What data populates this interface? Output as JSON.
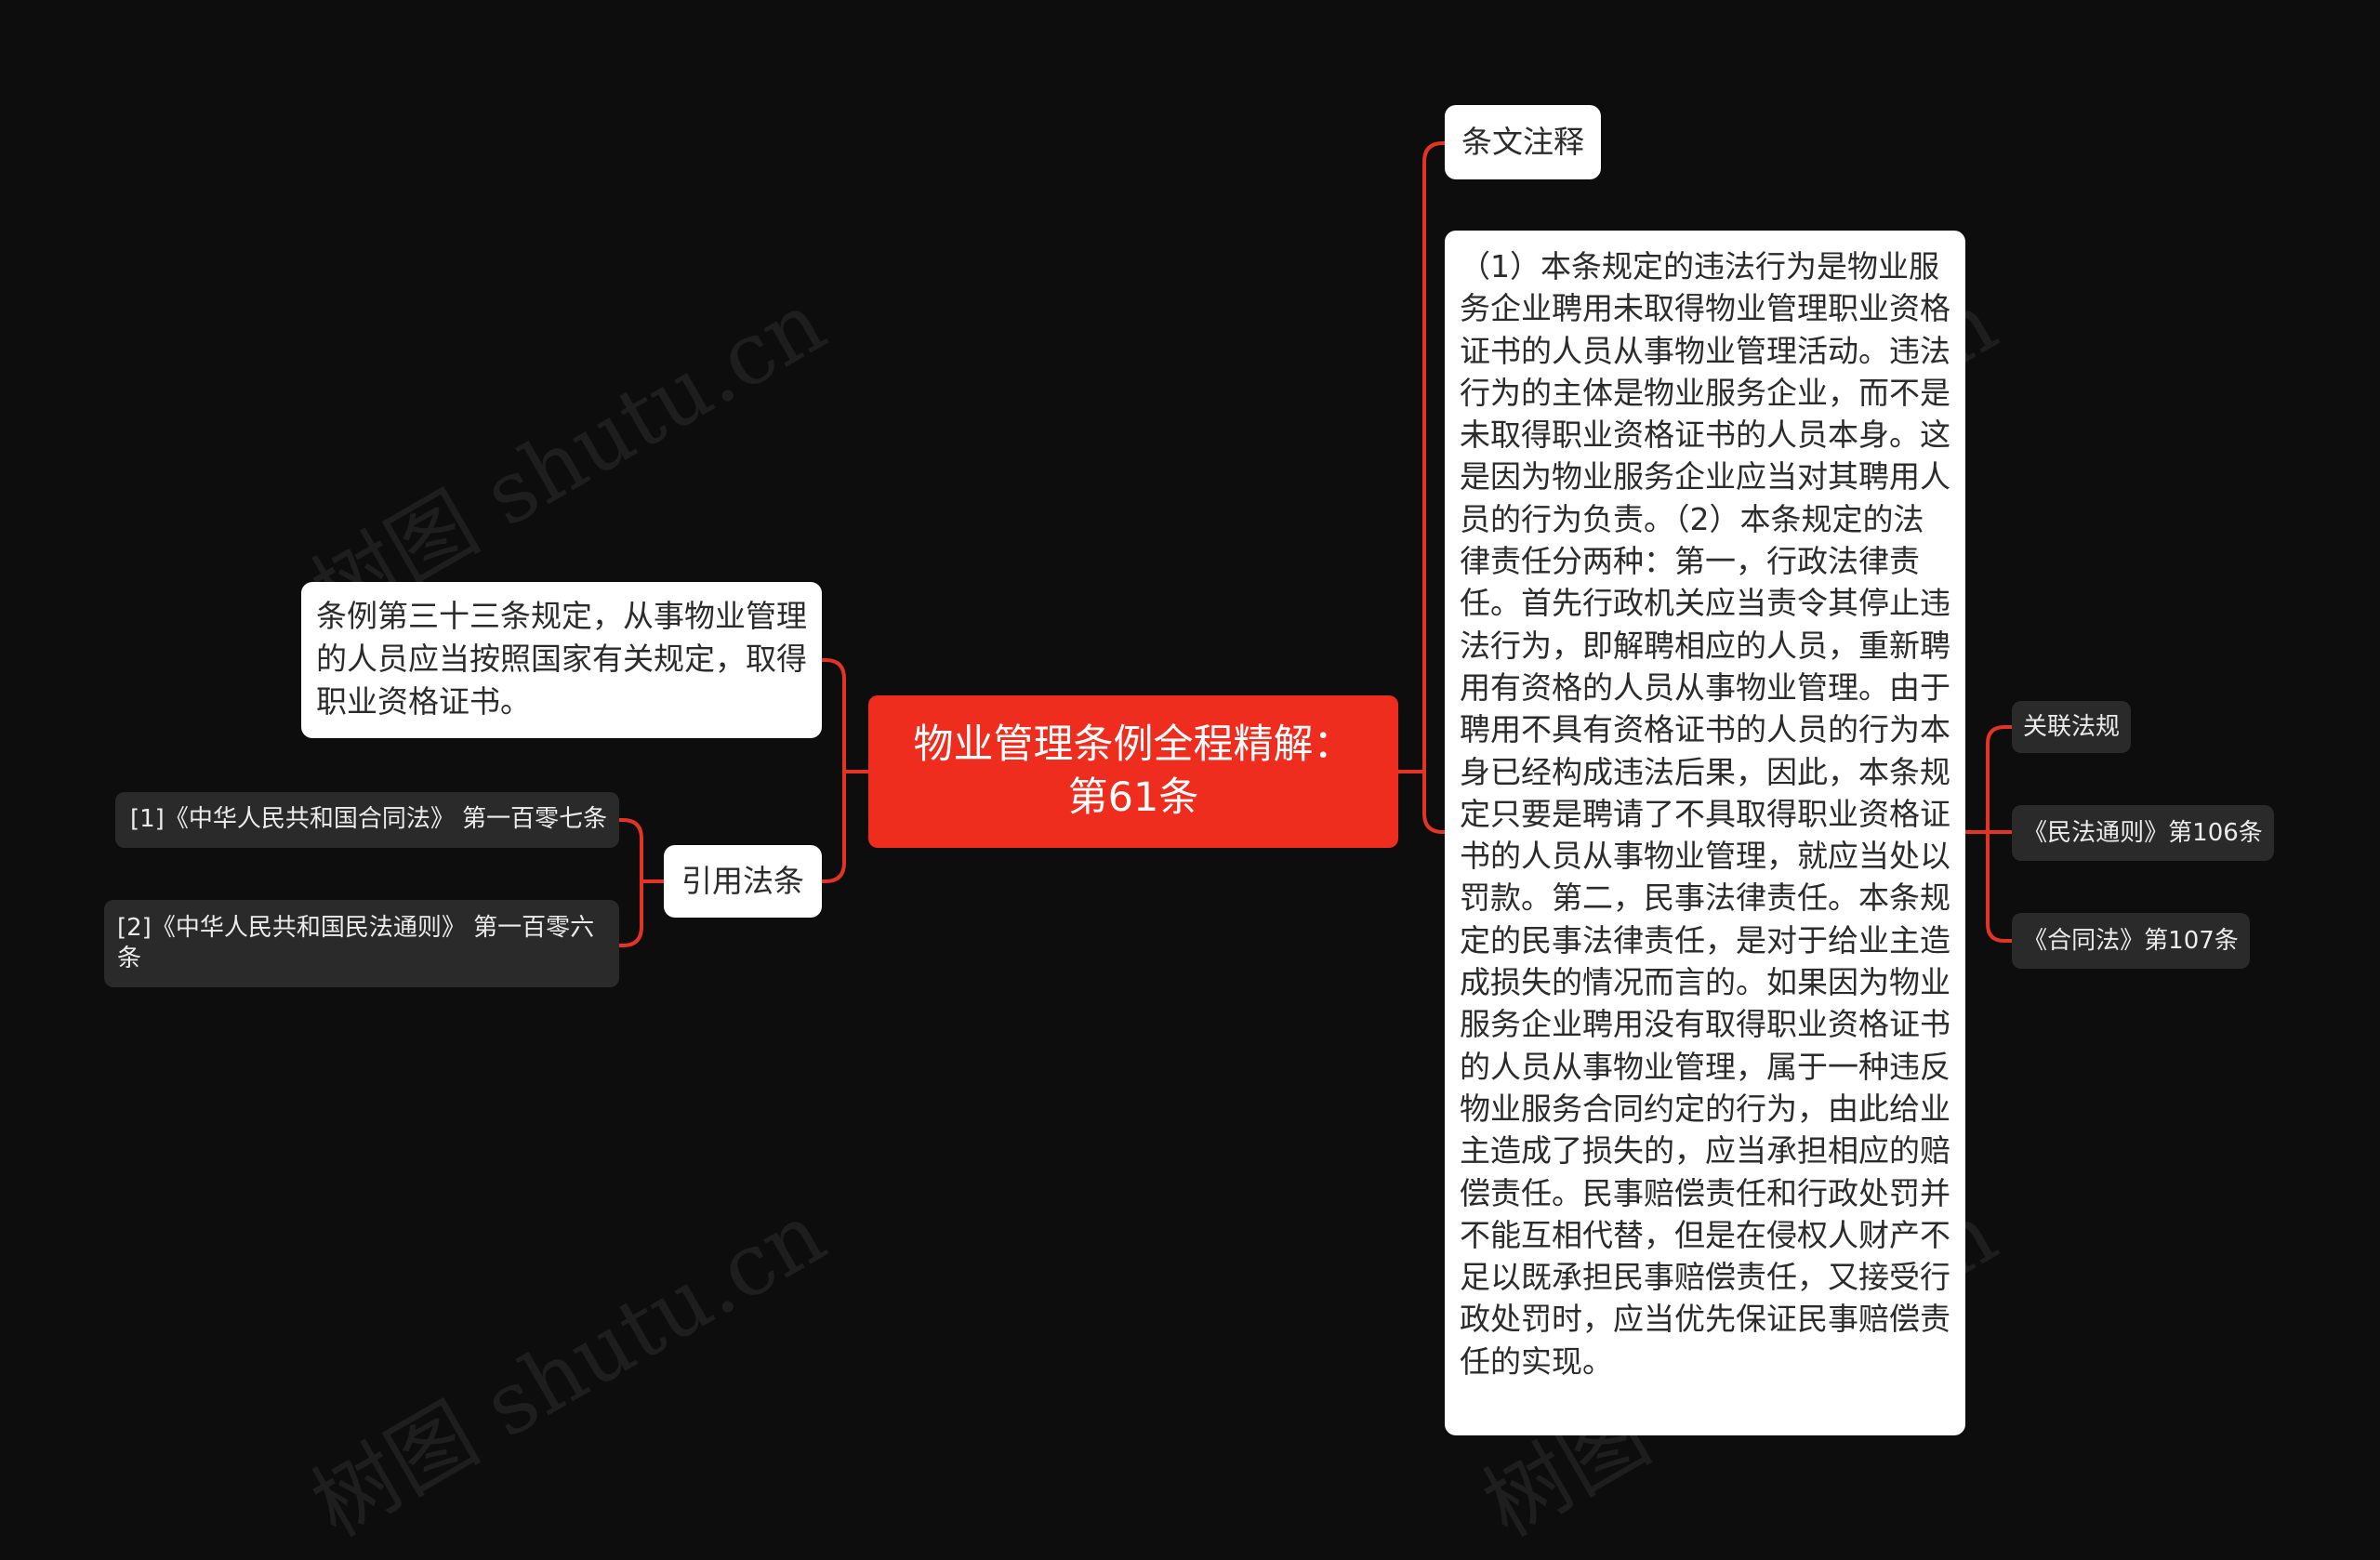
{
  "watermark": "树图 shutu.cn",
  "colors": {
    "background": "#0e0d0d",
    "root": "#ee2d1e",
    "connector": "#e33325",
    "node_light": "#ffffff",
    "node_dark": "#2b2a2a"
  },
  "root": {
    "line1": "物业管理条例全程精解：",
    "line2": "第61条"
  },
  "left": {
    "note": "条例第三十三条规定，从事物业管理的人员应当按照国家有关规定，取得职业资格证书。",
    "cited": {
      "label": "引用法条",
      "items": [
        "[1]《中华人民共和国合同法》 第一百零七条",
        "[2]《中华人民共和国民法通则》 第一百零六条"
      ]
    }
  },
  "right": {
    "annotation_title": "条文注释",
    "annotation_text": "（1）本条规定的违法行为是物业服务企业聘用未取得物业管理职业资格证书的人员从事物业管理活动。违法行为的主体是物业服务企业，而不是未取得职业资格证书的人员本身。这是因为物业服务企业应当对其聘用人员的行为负责。（2）本条规定的法律责任分两种：第一，行政法律责任。首先行政机关应当责令其停止违法行为，即解聘相应的人员，重新聘用有资格的人员从事物业管理。由于聘用不具有资格证书的人员的行为本身已经构成违法后果，因此，本条规定只要是聘请了不具取得职业资格证书的人员从事物业管理，就应当处以罚款。第二，民事法律责任。本条规定的民事法律责任，是对于给业主造成损失的情况而言的。如果因为物业服务企业聘用没有取得职业资格证书的人员从事物业管理，属于一种违反物业服务合同约定的行为，由此给业主造成了损失的，应当承担相应的赔偿责任。民事赔偿责任和行政处罚并不能互相代替，但是在侵权人财产不足以既承担民事赔偿责任，又接受行政处罚时，应当优先保证民事赔偿责任的实现。",
    "related": {
      "title": "关联法规",
      "items": [
        "《民法通则》第106条",
        "《合同法》第107条"
      ]
    }
  }
}
